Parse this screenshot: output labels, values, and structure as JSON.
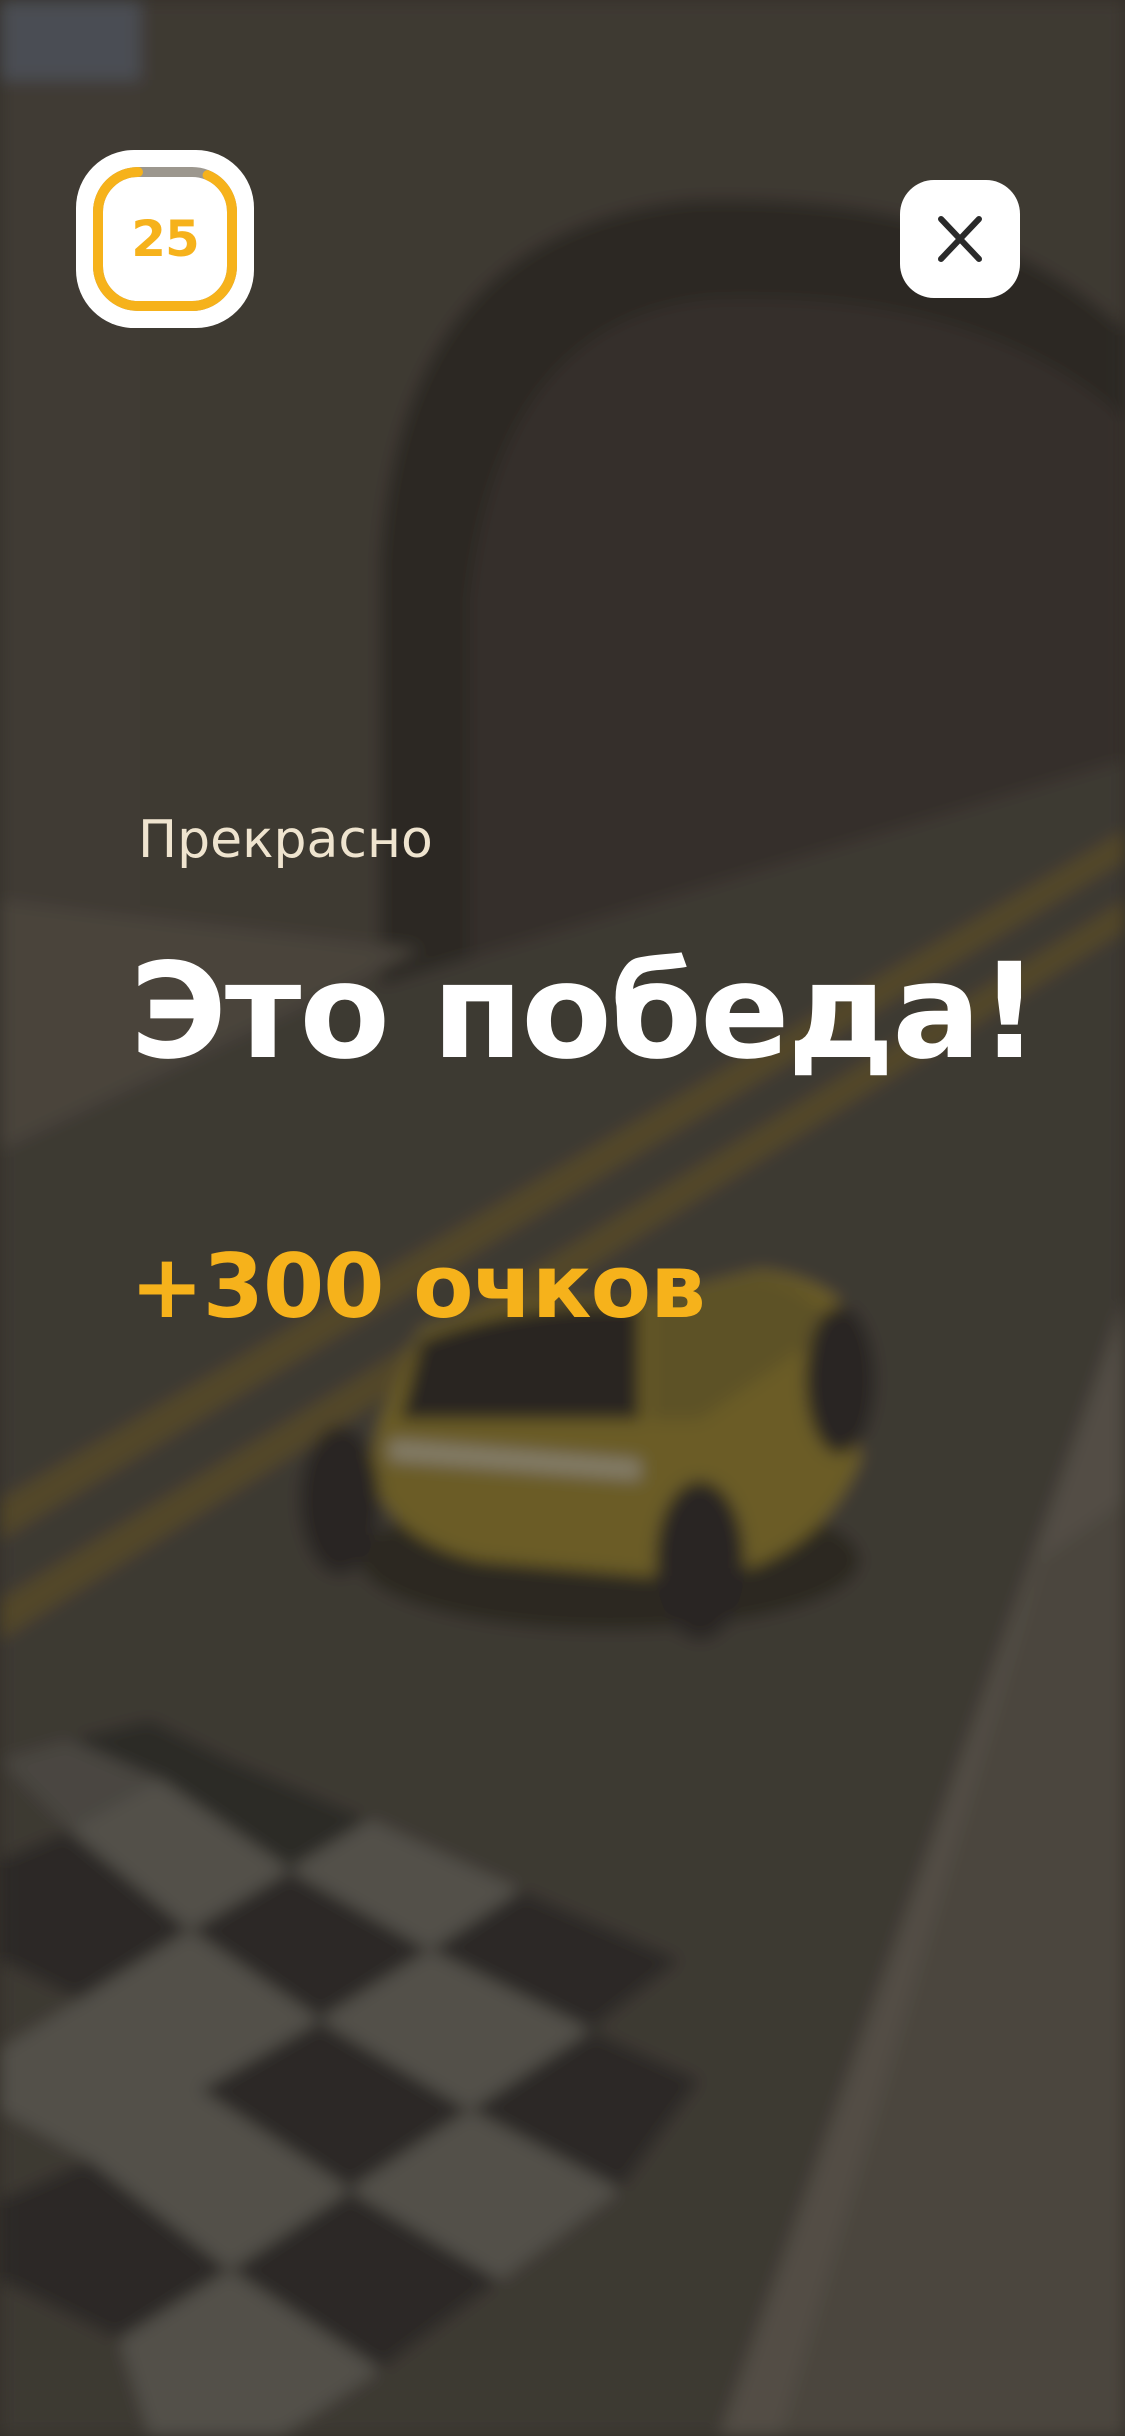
{
  "timer": {
    "value": "25",
    "progress": 0.85
  },
  "close": {
    "icon": "close-icon"
  },
  "result": {
    "subtitle": "Прекрасно",
    "title": "Это победа!",
    "points": "+300 очков"
  },
  "colors": {
    "accent": "#f6b21b",
    "card": "#ffffff",
    "subtitle": "#efe4cf"
  }
}
